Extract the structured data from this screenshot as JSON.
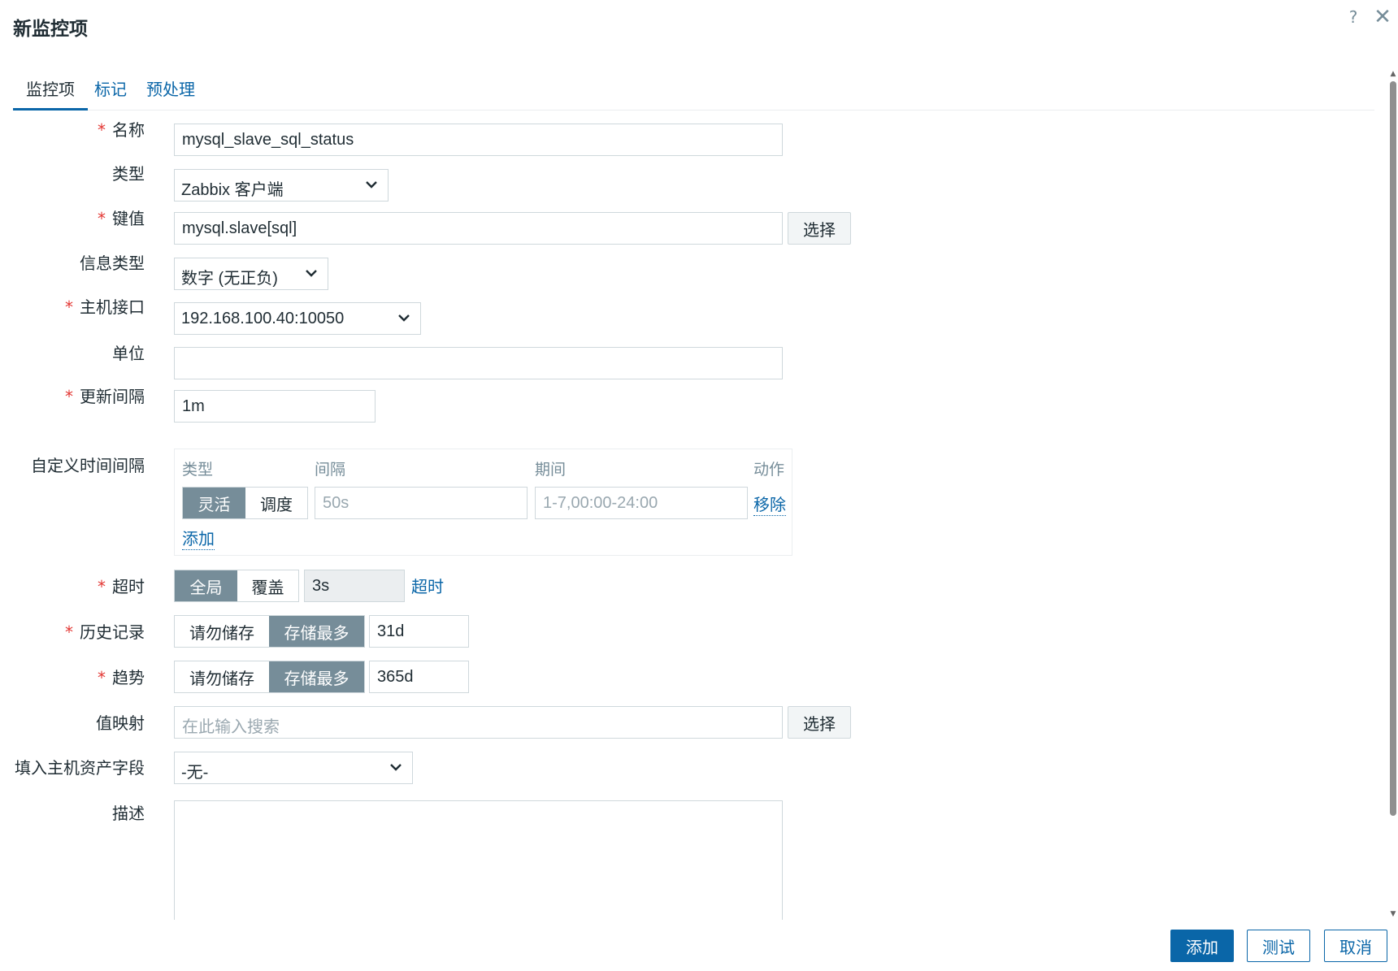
{
  "dialog": {
    "title": "新监控项",
    "help_icon": "question-icon",
    "close_icon": "close-icon"
  },
  "tabs": [
    {
      "label": "监控项",
      "active": true
    },
    {
      "label": "标记",
      "active": false
    },
    {
      "label": "预处理",
      "active": false
    }
  ],
  "form": {
    "name": {
      "label": "名称",
      "required": true,
      "value": "mysql_slave_sql_status"
    },
    "type": {
      "label": "类型",
      "value": "Zabbix 客户端"
    },
    "key": {
      "label": "键值",
      "required": true,
      "value": "mysql.slave[sql]",
      "select_label": "选择"
    },
    "info_type": {
      "label": "信息类型",
      "value": "数字 (无正负)"
    },
    "host_interface": {
      "label": "主机接口",
      "required": true,
      "value": "192.168.100.40:10050"
    },
    "units": {
      "label": "单位",
      "value": ""
    },
    "update_interval": {
      "label": "更新间隔",
      "required": true,
      "value": "1m"
    },
    "custom_intervals": {
      "label": "自定义时间间隔",
      "headers": {
        "type": "类型",
        "interval": "间隔",
        "period": "期间",
        "action": "动作"
      },
      "row": {
        "flexible": "灵活",
        "scheduling": "调度",
        "interval_placeholder": "50s",
        "period_placeholder": "1-7,00:00-24:00",
        "remove": "移除"
      },
      "add": "添加"
    },
    "timeout": {
      "label": "超时",
      "required": true,
      "global": "全局",
      "override": "覆盖",
      "value": "3s",
      "link": "超时"
    },
    "history": {
      "label": "历史记录",
      "required": true,
      "no_store": "请勿储存",
      "store_up_to": "存储最多",
      "value": "31d"
    },
    "trends": {
      "label": "趋势",
      "required": true,
      "no_store": "请勿储存",
      "store_up_to": "存储最多",
      "value": "365d"
    },
    "value_map": {
      "label": "值映射",
      "placeholder": "在此输入搜索",
      "select_label": "选择"
    },
    "inventory": {
      "label": "填入主机资产字段",
      "value": "-无-"
    },
    "description": {
      "label": "描述",
      "value": ""
    }
  },
  "footer": {
    "add": "添加",
    "test": "测试",
    "cancel": "取消"
  },
  "colors": {
    "accent": "#0a66a8",
    "segment_active": "#768d99",
    "required": "#e33734"
  }
}
